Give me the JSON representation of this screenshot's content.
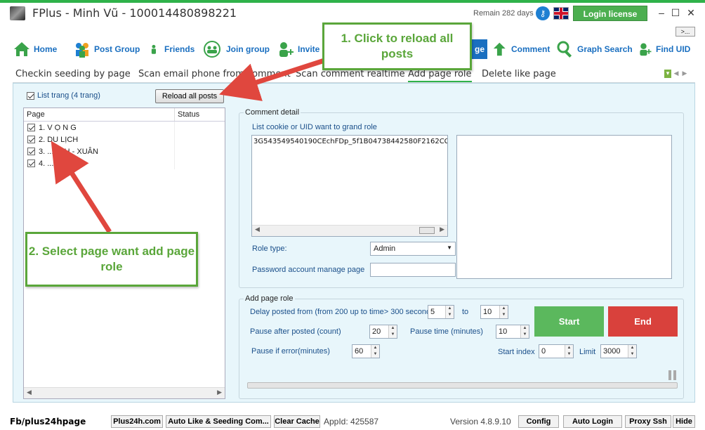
{
  "window": {
    "title": "FPlus - Minh Vũ - 100014480898221",
    "remain": "Remain 282 days",
    "login_license": "Login license",
    "minimize": "–",
    "maximize": "☐",
    "close": "✕",
    "more": ">..."
  },
  "nav": {
    "items": [
      {
        "label": "Home",
        "icon": "home-icon"
      },
      {
        "label": "Post Group",
        "icon": "group-icon"
      },
      {
        "label": "Friends",
        "icon": "friend-icon"
      },
      {
        "label": "Join group",
        "icon": "join-group-icon"
      },
      {
        "label": "Invite",
        "icon": "invite-icon"
      },
      {
        "label": "ge",
        "icon": "page-icon"
      },
      {
        "label": "Comment",
        "icon": "up-arrow-icon"
      },
      {
        "label": "Graph Search",
        "icon": "search-icon"
      },
      {
        "label": "Find UID",
        "icon": "find-uid-icon"
      }
    ]
  },
  "subtabs": [
    "Checkin seeding by page",
    "Scan email phone from comment",
    "Scan comment realtime",
    "Add page role",
    "Delete like page"
  ],
  "left_panel": {
    "list_label": "List trang (4 trang)",
    "reload_button": "Reload all posts",
    "col_page": "Page",
    "col_status": "Status",
    "pages": [
      "1. V Ọ N G",
      "2. DU LỊCH",
      "3. ...ANH - XUÂN",
      "4. ..."
    ]
  },
  "comment_detail": {
    "title": "Comment detail",
    "cookie_label": "List cookie or UID want to grand role",
    "cookie_value": "3G543549540190CEchFDp_5f1B04738442580F2162CC;",
    "role_label": "Role type:",
    "role_value": "Admin",
    "password_label": "Password account manage page"
  },
  "add_page_role": {
    "title": "Add page role",
    "delay_label": "Delay posted from (from 200 up to time> 300 seconds)",
    "delay_from": "5",
    "to_label": "to",
    "delay_to": "10",
    "pause_after_label": "Pause after posted (count)",
    "pause_after": "20",
    "pause_time_label": "Pause time (minutes)",
    "pause_time": "10",
    "pause_error_label": "Pause if error(minutes)",
    "pause_error": "60",
    "start_index_label": "Start index",
    "start_index": "0",
    "limit_label": "Limit",
    "limit": "3000",
    "start_button": "Start",
    "end_button": "End"
  },
  "statusbar": {
    "fb_label": "Fb/plus24hpage",
    "plus24h": "Plus24h.com",
    "auto_like": "Auto Like & Seeding Com...",
    "clear_cache": "Clear Cache",
    "appid": "AppId: 425587",
    "version": "Version 4.8.9.10",
    "config": "Config",
    "auto_login": "Auto Login",
    "proxy_ssh": "Proxy Ssh",
    "hide": "Hide"
  },
  "callouts": {
    "one": "1. Click to reload all posts",
    "two": "2. Select page want add page role"
  },
  "colors": {
    "accent_green": "#2fb24a",
    "nav_blue": "#1a6fc0",
    "start": "#5bb85d",
    "end": "#d9413c",
    "arrow_red": "#e0473e"
  }
}
